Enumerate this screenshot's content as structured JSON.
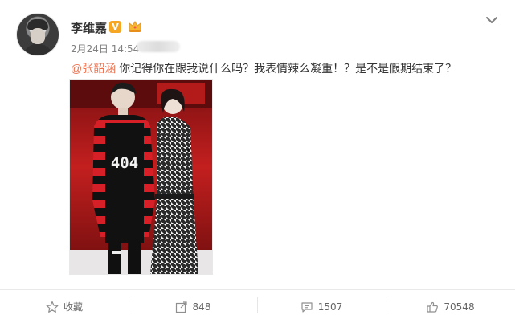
{
  "user": {
    "name": "李维嘉",
    "verified_badge": "V",
    "posted_at": "2月24日 14:54"
  },
  "post": {
    "mention": "@张韶涵",
    "text": " 你记得你在跟我说什么吗？我表情辣么凝重！？是不是假期结束了？",
    "image": {
      "shirt_text": "404"
    }
  },
  "actions": [
    {
      "label": "收藏",
      "icon": "star-icon"
    },
    {
      "label": "848",
      "icon": "share-icon"
    },
    {
      "label": "1507",
      "icon": "comment-icon"
    },
    {
      "label": "70548",
      "icon": "like-icon"
    }
  ],
  "colors": {
    "mention": "#eb7350",
    "verified": "#f5a623",
    "text": "#333333",
    "meta": "#808080"
  }
}
